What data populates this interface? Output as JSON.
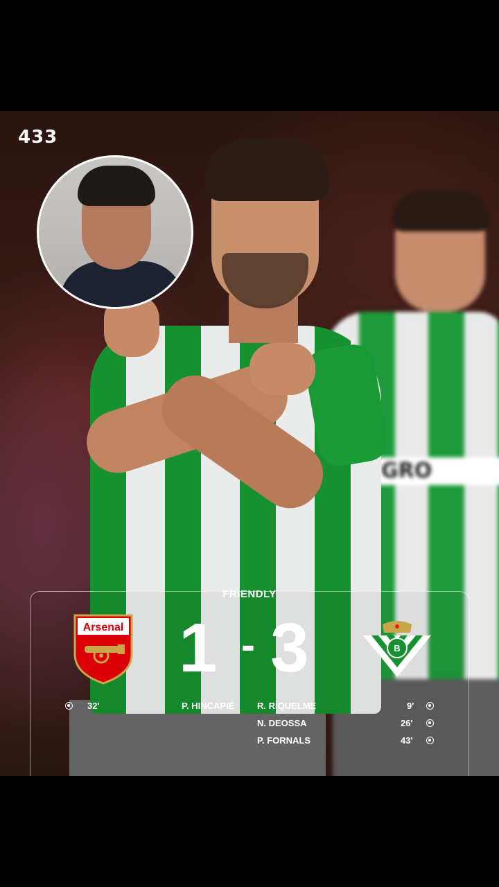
{
  "brand": {
    "logo_text": "433"
  },
  "match": {
    "label": "FRIENDLY",
    "home": {
      "name": "Arsenal",
      "score": "1"
    },
    "away": {
      "name": "Real Betis",
      "score": "3"
    },
    "separator": "-",
    "home_goals": [
      {
        "player": "P. HINCAPIÉ",
        "minute": "32'"
      }
    ],
    "away_goals": [
      {
        "player": "R. RIQUELME",
        "minute": "9'"
      },
      {
        "player": "N. DEOSSA",
        "minute": "26'"
      },
      {
        "player": "P. FORNALS",
        "minute": "43'"
      }
    ]
  },
  "colors": {
    "betis_green": "#17902f",
    "arsenal_red": "#db0007",
    "background": "#000000"
  },
  "icons": [
    "ball-icon",
    "arsenal-crest-icon",
    "betis-crest-icon"
  ]
}
